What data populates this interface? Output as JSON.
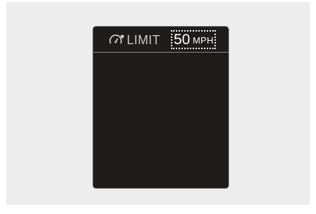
{
  "header": {
    "icon": "speed-limit-gauge-icon",
    "label": "LIMIT"
  },
  "speed_limit": {
    "value": "50",
    "unit": "MPH"
  },
  "colors": {
    "panel_background": "#1e1d1c",
    "panel_border": "#7c7c7c",
    "text": "#ffffff",
    "label_text": "#c8c8c8"
  }
}
